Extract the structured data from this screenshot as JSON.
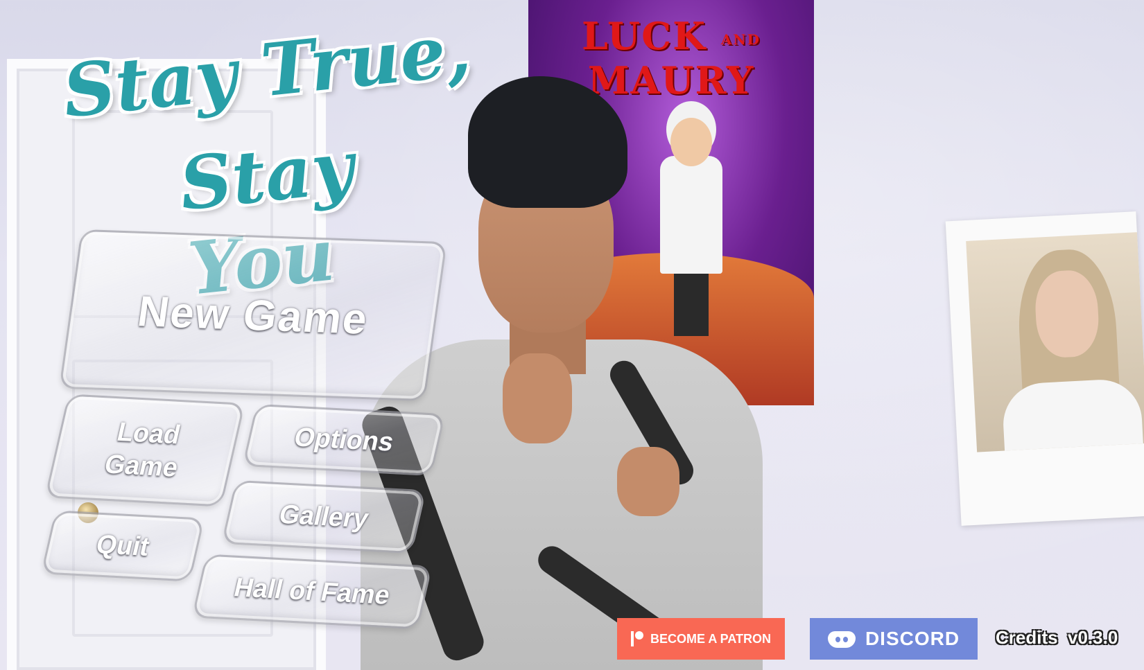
{
  "logo": {
    "line1": "Stay True,",
    "line2": "Stay You",
    "color": "#2aa0a8"
  },
  "poster": {
    "title_left": "LUCK",
    "title_and": "AND",
    "title_right": "MAURY"
  },
  "menu": {
    "new_game": "New Game",
    "load_game": "Load\nGame",
    "options": "Options",
    "gallery": "Gallery",
    "quit": "Quit",
    "hall_of_fame": "Hall of Fame"
  },
  "footer": {
    "patron_label": "BECOME A PATRON",
    "patron_color": "#f96854",
    "discord_label": "DISCORD",
    "discord_color": "#7289da",
    "credits_label": "Credits",
    "version": "v0.3.0"
  }
}
